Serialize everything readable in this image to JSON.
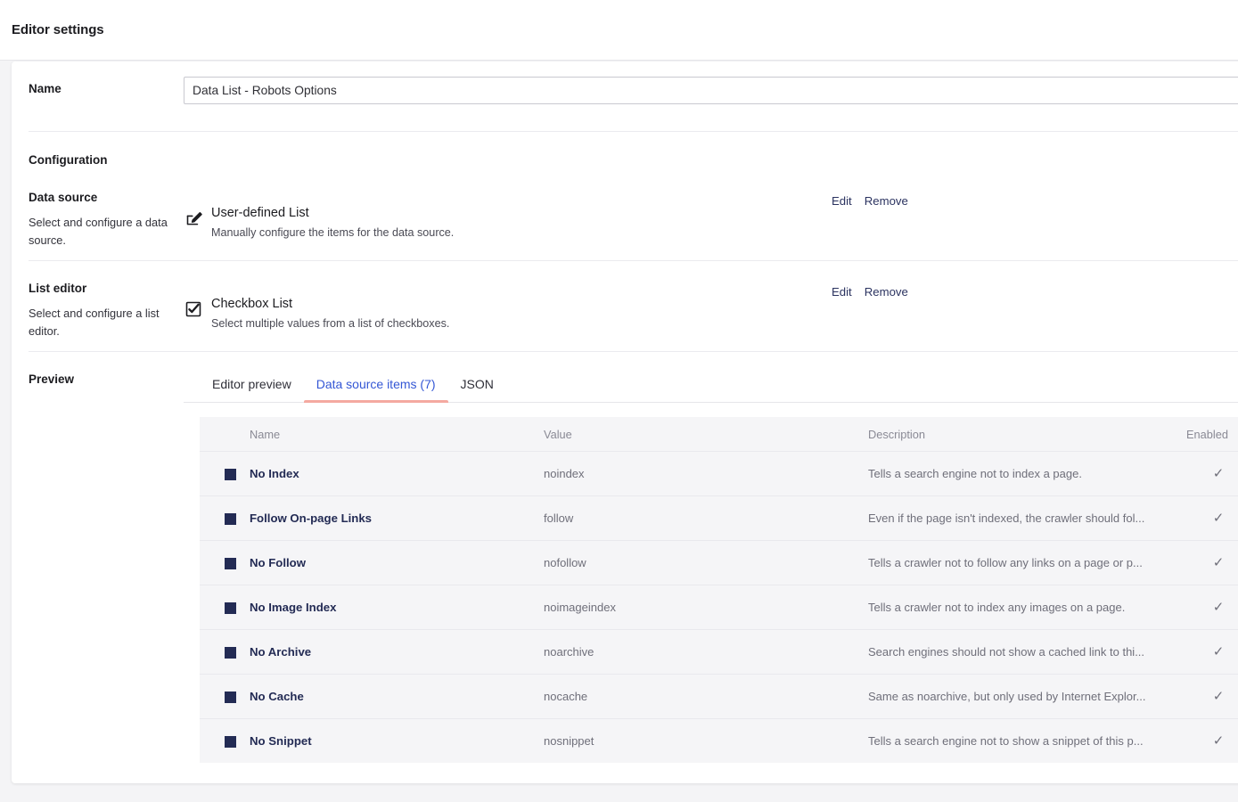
{
  "header": {
    "title": "Editor settings"
  },
  "form": {
    "name": {
      "label": "Name",
      "value": "Data List - Robots Options",
      "placeholder": "Name"
    },
    "configuration_heading": "Configuration",
    "data_source": {
      "label": "Data source",
      "description": "Select and configure a data source.",
      "option_title": "User-defined List",
      "option_desc": "Manually configure the items for the data source.",
      "icon": "pencil-square-icon",
      "edit_label": "Edit",
      "remove_label": "Remove"
    },
    "list_editor": {
      "label": "List editor",
      "description": "Select and configure a list editor.",
      "option_title": "Checkbox List",
      "option_desc": "Select multiple values from a list of checkboxes.",
      "icon": "checkbox-checked-icon",
      "edit_label": "Edit",
      "remove_label": "Remove"
    },
    "preview": {
      "label": "Preview",
      "tabs": [
        {
          "label": "Editor preview",
          "active": false
        },
        {
          "label": "Data source items (7)",
          "active": true
        },
        {
          "label": "JSON",
          "active": false
        }
      ],
      "active_tab_index": 1,
      "table": {
        "columns": [
          "",
          "Name",
          "Value",
          "Description",
          "Enabled"
        ],
        "rows": [
          {
            "name": "No Index",
            "value": "noindex",
            "description": "Tells a search engine not to index a page.",
            "enabled": "✓"
          },
          {
            "name": "Follow On-page Links",
            "value": "follow",
            "description": "Even if the page isn't indexed, the crawler should fol...",
            "enabled": "✓"
          },
          {
            "name": "No Follow",
            "value": "nofollow",
            "description": "Tells a crawler not to follow any links on a page or p...",
            "enabled": "✓"
          },
          {
            "name": "No Image Index",
            "value": "noimageindex",
            "description": "Tells a crawler not to index any images on a page.",
            "enabled": "✓"
          },
          {
            "name": "No Archive",
            "value": "noarchive",
            "description": "Search engines should not show a cached link to thi...",
            "enabled": "✓"
          },
          {
            "name": "No Cache",
            "value": "nocache",
            "description": "Same as noarchive, but only used by Internet Explor...",
            "enabled": "✓"
          },
          {
            "name": "No Snippet",
            "value": "nosnippet",
            "description": "Tells a search engine not to show a snippet of this p...",
            "enabled": "✓"
          }
        ]
      }
    }
  },
  "colors": {
    "accent_blue": "#3457d5",
    "tab_underline": "#f4a9a0",
    "navy": "#232b54",
    "muted": "#6f6f7a",
    "page_bg": "#f4f4f6",
    "table_bg": "#f5f5f7"
  }
}
